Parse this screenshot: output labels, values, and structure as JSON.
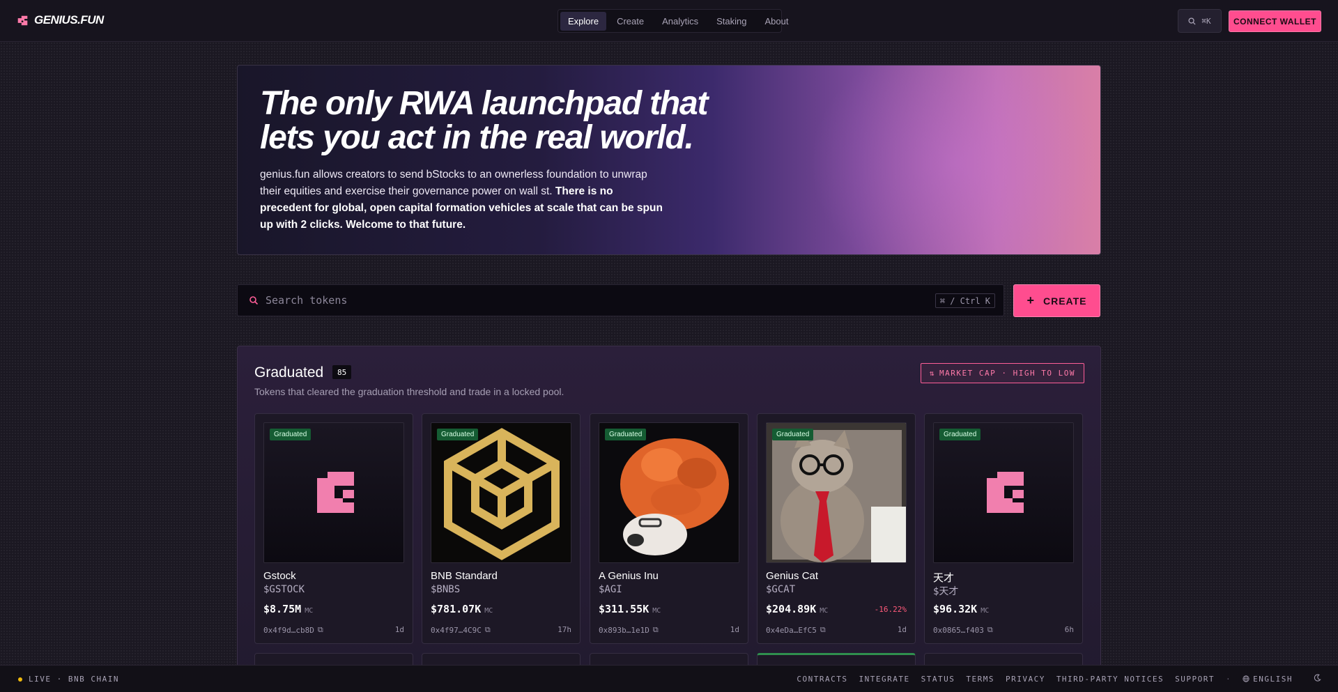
{
  "app": {
    "logo_text": "GENIUS.FUN",
    "accent_color": "#ff4d8f",
    "graduated_badge_color": "#155c33"
  },
  "nav": {
    "items": [
      "Explore",
      "Create",
      "Analytics",
      "Staking",
      "About"
    ],
    "active": "Explore"
  },
  "header": {
    "search_shortcut": "⌘K",
    "connect_wallet": "CONNECT WALLET"
  },
  "hero": {
    "title_line1": "The only RWA launchpad that",
    "title_line2": "lets you act in the real world.",
    "text_plain": "genius.fun allows creators to send bStocks to an ownerless foundation to unwrap their equities and exercise their governance power on wall st.",
    "text_bold": "There is no precedent for global, open capital formation vehicles at scale that can be spun up with 2 clicks. Welcome to that future."
  },
  "search": {
    "placeholder": "Search tokens",
    "value": "",
    "shortcut_hint": "⌘ / Ctrl K"
  },
  "create_button": {
    "icon": "plus-icon",
    "label": "CREATE"
  },
  "graduated": {
    "title": "Graduated",
    "count": "85",
    "subtitle": "Tokens that cleared the graduation threshold and trade in a locked pool.",
    "sort_label": "MARKET CAP · HIGH TO LOW",
    "badge_label": "Graduated",
    "mc_suffix": "MC",
    "cards": [
      {
        "name": "Gstock",
        "ticker": "$GSTOCK",
        "market_cap": "$8.75M",
        "change": "",
        "address": "0x4f9d…cb8D",
        "age": "1d",
        "image": "genius-logo-icon"
      },
      {
        "name": "BNB Standard",
        "ticker": "$BNBS",
        "market_cap": "$781.07K",
        "change": "",
        "address": "0x4f97…4C9C",
        "age": "17h",
        "image": "gold-cube-icon"
      },
      {
        "name": "A Genius Inu",
        "ticker": "$AGI",
        "market_cap": "$311.55K",
        "change": "",
        "address": "0x893b…1e1D",
        "age": "1d",
        "image": "brain-dog-icon"
      },
      {
        "name": "Genius Cat",
        "ticker": "$GCAT",
        "market_cap": "$204.89K",
        "change": "-16.22%",
        "address": "0x4eDa…EfC5",
        "age": "1d",
        "image": "cat-with-glasses-icon"
      },
      {
        "name": "天才",
        "ticker": "$天才",
        "market_cap": "$96.32K",
        "change": "",
        "address": "0x0865…f403",
        "age": "6h",
        "image": "genius-logo-icon"
      }
    ]
  },
  "footer": {
    "status": "LIVE · BNB CHAIN",
    "links": [
      "CONTRACTS",
      "INTEGRATE",
      "STATUS",
      "TERMS",
      "PRIVACY",
      "THIRD-PARTY NOTICES",
      "SUPPORT"
    ],
    "separator": "·",
    "language": "ENGLISH"
  }
}
